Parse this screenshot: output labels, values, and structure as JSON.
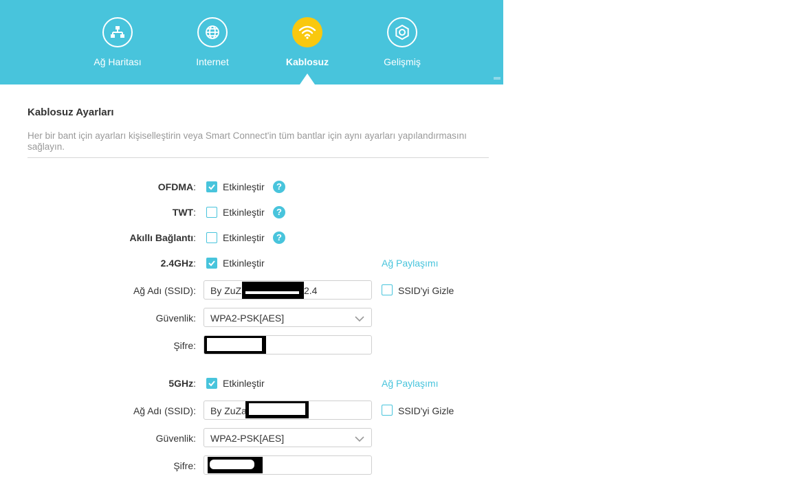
{
  "nav": {
    "items": [
      {
        "label": "Ağ Haritası",
        "icon": "network-map-icon"
      },
      {
        "label": "Internet",
        "icon": "globe-icon"
      },
      {
        "label": "Kablosuz",
        "icon": "wifi-icon",
        "active": true
      },
      {
        "label": "Gelişmiş",
        "icon": "gear-icon"
      }
    ]
  },
  "colors": {
    "accent": "#48c4dc",
    "active_icon": "#f9c80e",
    "link": "#48c4dc"
  },
  "section": {
    "title": "Kablosuz Ayarları",
    "description": "Her bir bant için ayarları kişiselleştirin veya Smart Connect'in tüm bantlar için aynı ayarları yapılandırmasını sağlayın."
  },
  "options": {
    "ofdma": {
      "label": "OFDMA",
      "checkbox_label": "Etkinleştir",
      "checked": true
    },
    "twt": {
      "label": "TWT",
      "checkbox_label": "Etkinleştir",
      "checked": false
    },
    "smart_connect": {
      "label": "Akıllı Bağlantı",
      "checkbox_label": "Etkinleştir",
      "checked": false
    },
    "help_glyph": "?"
  },
  "band24": {
    "label": "2.4GHz",
    "enable_label": "Etkinleştir",
    "enabled": true,
    "share_link": "Ağ Paylaşımı",
    "ssid_label": "Ağ Adı (SSID):",
    "ssid_prefix": "By ZuZ",
    "ssid_suffix": "2.4",
    "hide_ssid_label": "SSID'yi Gizle",
    "security_label": "Güvenlik:",
    "security_value": "WPA2-PSK[AES]",
    "password_label": "Şifre:"
  },
  "band5": {
    "label": "5GHz",
    "enable_label": "Etkinleştir",
    "enabled": true,
    "share_link": "Ağ Paylaşımı",
    "ssid_label": "Ağ Adı (SSID):",
    "ssid_prefix": "By ZuZa",
    "hide_ssid_label": "SSID'yi Gizle",
    "security_label": "Güvenlik:",
    "security_value": "WPA2-PSK[AES]",
    "password_label": "Şifre:"
  }
}
